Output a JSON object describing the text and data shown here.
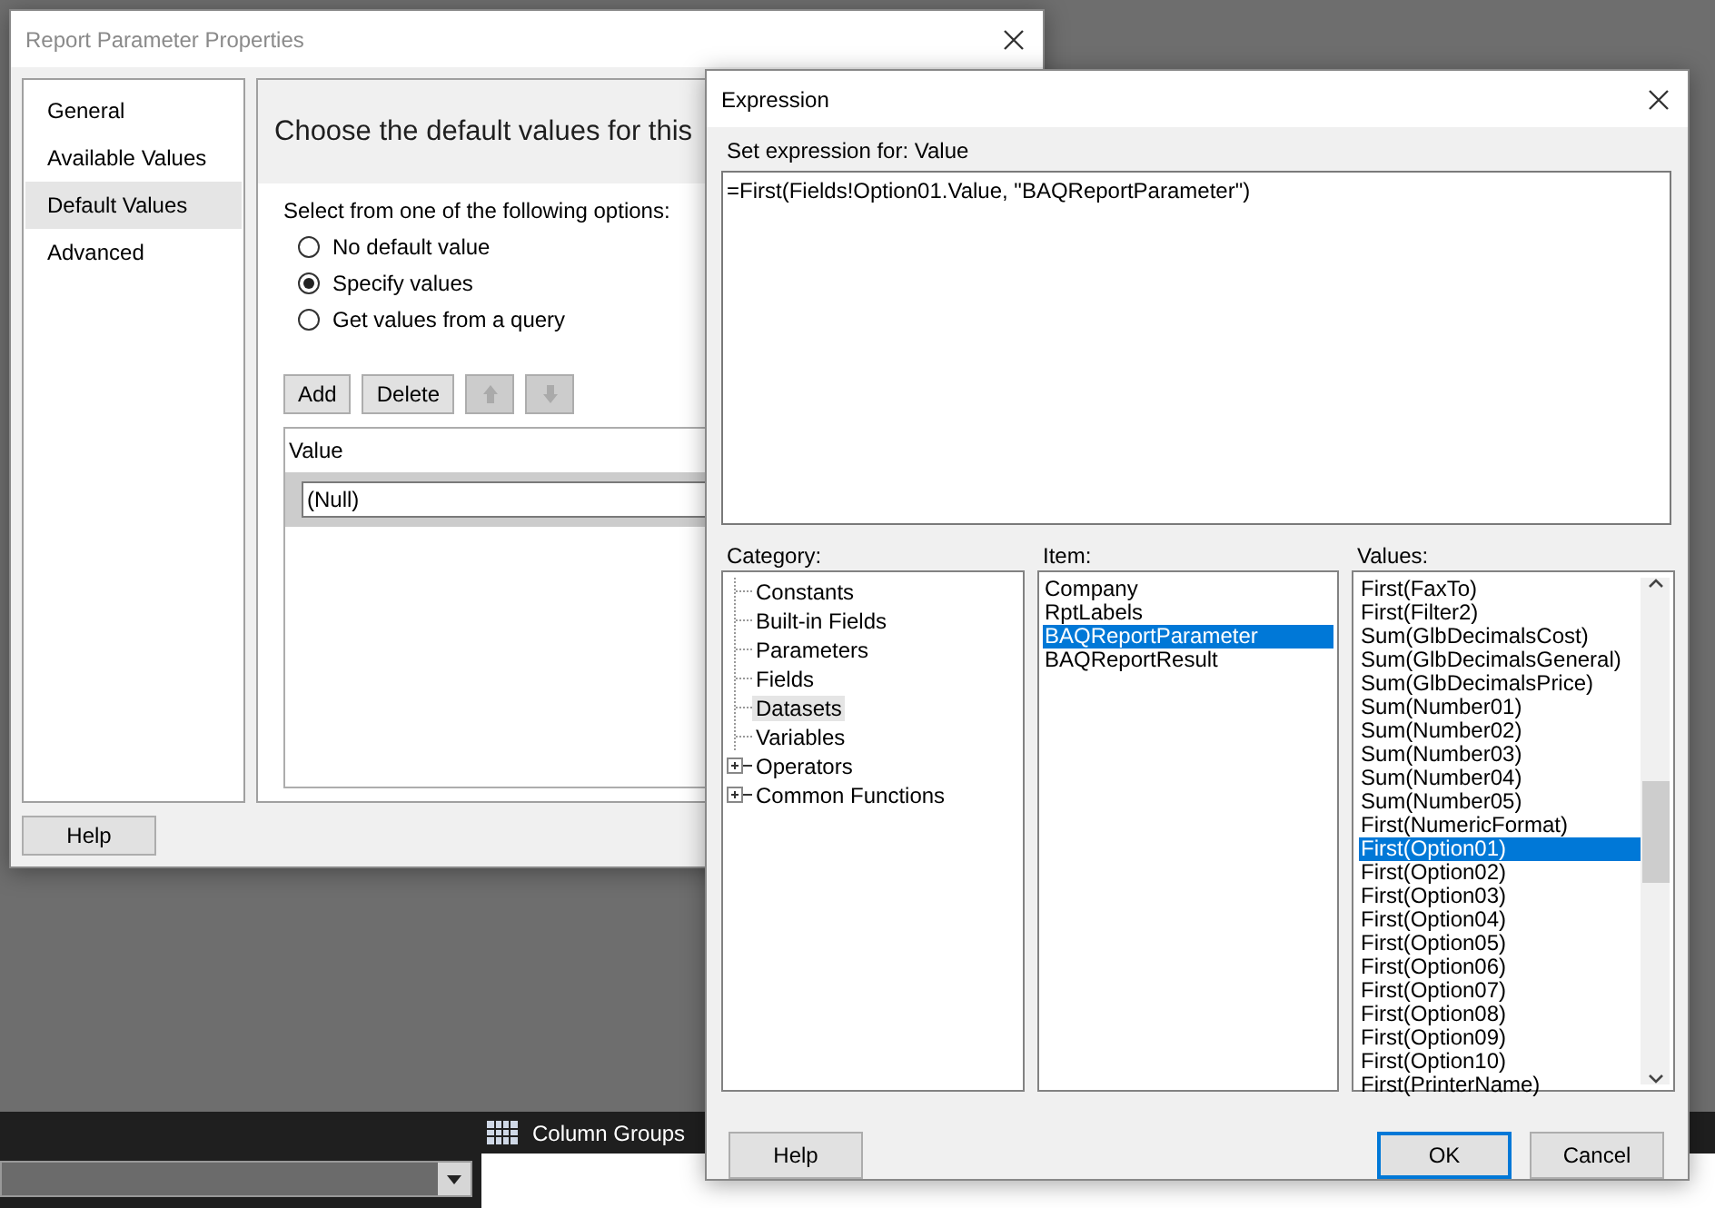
{
  "report_window": {
    "title": "Report Parameter Properties",
    "sidebar": {
      "items": [
        {
          "label": "General",
          "selected": false
        },
        {
          "label": "Available Values",
          "selected": false
        },
        {
          "label": "Default Values",
          "selected": true
        },
        {
          "label": "Advanced",
          "selected": false
        }
      ]
    },
    "heading": "Choose the default values for this",
    "options_label": "Select from one of the following options:",
    "options": [
      {
        "label": "No default value",
        "selected": false
      },
      {
        "label": "Specify values",
        "selected": true
      },
      {
        "label": "Get values from a query",
        "selected": false
      }
    ],
    "toolbar": [
      {
        "kind": "text",
        "label": "Add",
        "disabled": false
      },
      {
        "kind": "text",
        "label": "Delete",
        "disabled": false
      },
      {
        "kind": "up",
        "disabled": true
      },
      {
        "kind": "down",
        "disabled": true
      }
    ],
    "table": {
      "columns": [
        "Value"
      ],
      "rows": [
        {
          "value": "(Null)",
          "selected": true
        }
      ]
    },
    "help_button": "Help"
  },
  "expression_window": {
    "title": "Expression",
    "set_label": "Set expression for: Value",
    "expression": "=First(Fields!Option01.Value, \"BAQReportParameter\")",
    "category_label": "Category:",
    "categories": [
      {
        "label": "Constants",
        "kind": "leaf",
        "selected": false
      },
      {
        "label": "Built-in Fields",
        "kind": "leaf",
        "selected": false
      },
      {
        "label": "Parameters",
        "kind": "leaf",
        "selected": false
      },
      {
        "label": "Fields",
        "kind": "leaf",
        "selected": false
      },
      {
        "label": "Datasets",
        "kind": "leaf",
        "selected": true
      },
      {
        "label": "Variables",
        "kind": "leaf",
        "selected": false
      },
      {
        "label": "Operators",
        "kind": "collapsed",
        "selected": false
      },
      {
        "label": "Common Functions",
        "kind": "collapsed",
        "selected": false
      }
    ],
    "item_label": "Item:",
    "items": [
      {
        "label": "Company",
        "selected": false
      },
      {
        "label": "RptLabels",
        "selected": false
      },
      {
        "label": "BAQReportParameter",
        "selected": true
      },
      {
        "label": "BAQReportResult",
        "selected": false
      }
    ],
    "values_label": "Values:",
    "values": [
      {
        "label": "First(FaxTo)",
        "selected": false
      },
      {
        "label": "First(Filter2)",
        "selected": false
      },
      {
        "label": "Sum(GlbDecimalsCost)",
        "selected": false
      },
      {
        "label": "Sum(GlbDecimalsGeneral)",
        "selected": false
      },
      {
        "label": "Sum(GlbDecimalsPrice)",
        "selected": false
      },
      {
        "label": "Sum(Number01)",
        "selected": false
      },
      {
        "label": "Sum(Number02)",
        "selected": false
      },
      {
        "label": "Sum(Number03)",
        "selected": false
      },
      {
        "label": "Sum(Number04)",
        "selected": false
      },
      {
        "label": "Sum(Number05)",
        "selected": false
      },
      {
        "label": "First(NumericFormat)",
        "selected": false
      },
      {
        "label": "First(Option01)",
        "selected": true
      },
      {
        "label": "First(Option02)",
        "selected": false
      },
      {
        "label": "First(Option03)",
        "selected": false
      },
      {
        "label": "First(Option04)",
        "selected": false
      },
      {
        "label": "First(Option05)",
        "selected": false
      },
      {
        "label": "First(Option06)",
        "selected": false
      },
      {
        "label": "First(Option07)",
        "selected": false
      },
      {
        "label": "First(Option08)",
        "selected": false
      },
      {
        "label": "First(Option09)",
        "selected": false
      },
      {
        "label": "First(Option10)",
        "selected": false
      },
      {
        "label": "First(PrinterName)",
        "selected": false
      }
    ],
    "buttons": [
      {
        "label": "Help",
        "kind": "help"
      },
      {
        "label": "OK",
        "kind": "default"
      },
      {
        "label": "Cancel",
        "kind": "normal"
      }
    ]
  },
  "background": {
    "column_groups": "Column Groups"
  }
}
